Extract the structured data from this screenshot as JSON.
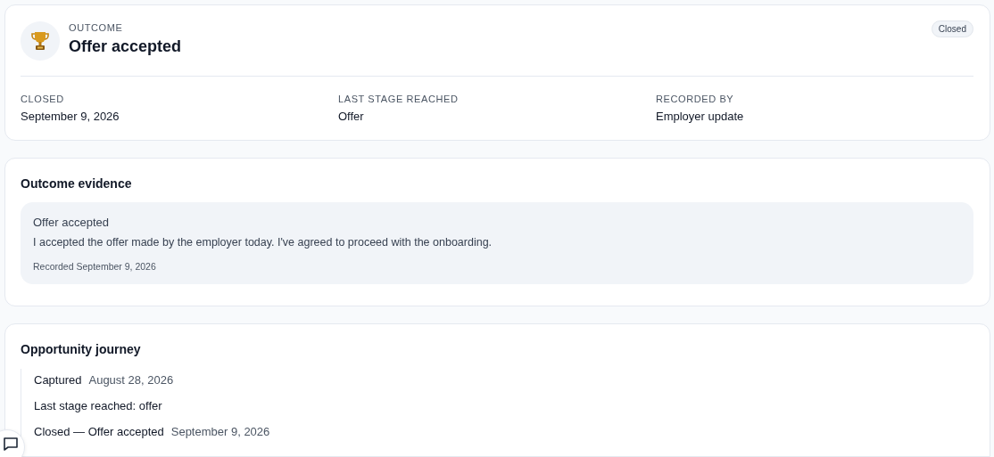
{
  "outcome": {
    "eyebrow": "OUTCOME",
    "title": "Offer accepted",
    "badge": "Closed",
    "facts": [
      {
        "label": "CLOSED",
        "value": "September 9, 2026"
      },
      {
        "label": "LAST STAGE REACHED",
        "value": "Offer"
      },
      {
        "label": "RECORDED BY",
        "value": "Employer update"
      }
    ]
  },
  "evidence": {
    "heading": "Outcome evidence",
    "title": "Offer accepted",
    "body": "I accepted the offer made by the employer today. I've agreed to proceed with the onboarding.",
    "recorded": "Recorded September 9, 2026"
  },
  "journey": {
    "heading": "Opportunity journey",
    "events": [
      {
        "label": "Captured",
        "date": "August 28, 2026"
      },
      {
        "label": "Last stage reached: offer"
      },
      {
        "label": "Closed — Offer accepted",
        "date": "September 9, 2026"
      }
    ]
  }
}
